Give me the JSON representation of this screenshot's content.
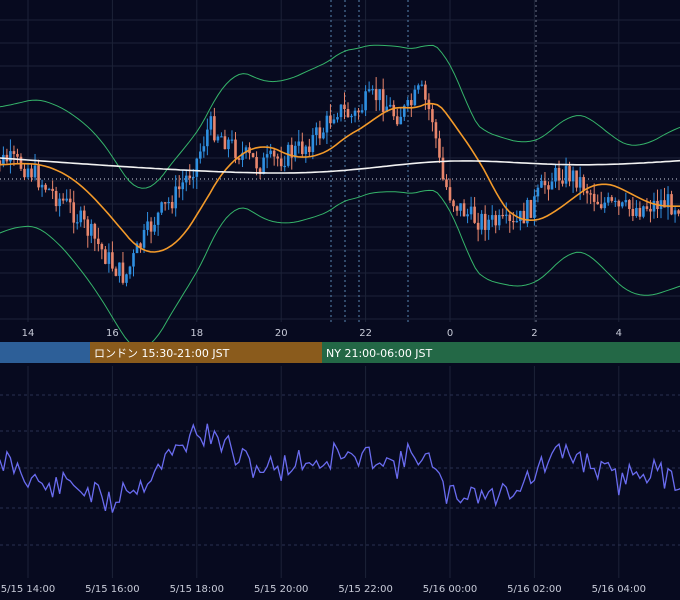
{
  "colors": {
    "background": "#070a1f",
    "grid": "#1c2238",
    "bull": "#2f8fe0",
    "bear": "#e8866c",
    "bollinger": "#35b46a",
    "ma_short": "#f39a2a",
    "ma_long": "#f2f2f2",
    "oscillator": "#6a6cf0",
    "session_tokyo": "#2d5f98",
    "session_london": "#8a5b1c",
    "session_ny": "#236846"
  },
  "chart_data": [
    {
      "type": "candlestick",
      "title": "",
      "x_ticks": [
        "14",
        "16",
        "18",
        "20",
        "22",
        "0",
        "2",
        "4"
      ],
      "series": [
        {
          "type": "candlestick"
        },
        {
          "type": "line",
          "indicator": "bollinger_upper"
        },
        {
          "type": "line",
          "indicator": "bollinger_lower"
        },
        {
          "type": "line",
          "indicator": "moving_average_short"
        },
        {
          "type": "line",
          "indicator": "moving_average_long"
        }
      ],
      "close_path": [
        [
          13.0,
          0.5
        ],
        [
          13.5,
          0.48
        ],
        [
          14.0,
          0.51
        ],
        [
          14.5,
          0.6
        ],
        [
          15.0,
          0.67
        ],
        [
          15.5,
          0.78
        ],
        [
          16.0,
          0.9
        ],
        [
          16.3,
          0.95
        ],
        [
          16.6,
          0.84
        ],
        [
          17.0,
          0.72
        ],
        [
          17.5,
          0.62
        ],
        [
          18.0,
          0.48
        ],
        [
          18.3,
          0.34
        ],
        [
          18.7,
          0.4
        ],
        [
          19.0,
          0.45
        ],
        [
          19.5,
          0.5
        ],
        [
          20.0,
          0.47
        ],
        [
          20.5,
          0.43
        ],
        [
          21.0,
          0.36
        ],
        [
          21.3,
          0.27
        ],
        [
          21.7,
          0.31
        ],
        [
          22.0,
          0.25
        ],
        [
          22.3,
          0.22
        ],
        [
          22.7,
          0.3
        ],
        [
          23.0,
          0.28
        ],
        [
          23.3,
          0.2
        ],
        [
          23.6,
          0.32
        ],
        [
          23.8,
          0.55
        ],
        [
          24.1,
          0.65
        ],
        [
          24.5,
          0.71
        ],
        [
          25.0,
          0.73
        ],
        [
          25.5,
          0.75
        ],
        [
          26.0,
          0.65
        ],
        [
          26.3,
          0.56
        ],
        [
          26.7,
          0.53
        ],
        [
          27.0,
          0.55
        ],
        [
          27.5,
          0.64
        ],
        [
          28.0,
          0.68
        ],
        [
          28.5,
          0.67
        ],
        [
          29.0,
          0.65
        ],
        [
          29.6,
          0.66
        ]
      ],
      "legend": "none"
    },
    {
      "type": "line",
      "title": "",
      "x_ticks": [
        "5/15 14:00",
        "5/15 16:00",
        "5/15 18:00",
        "5/15 20:00",
        "5/15 22:00",
        "5/16 00:00",
        "5/16 02:00",
        "5/16 04:00"
      ],
      "series": [
        {
          "type": "line",
          "indicator": "oscillator"
        }
      ],
      "path": [
        [
          13.0,
          0.55
        ],
        [
          13.5,
          0.4
        ],
        [
          14.0,
          0.5
        ],
        [
          14.5,
          0.6
        ],
        [
          15.0,
          0.55
        ],
        [
          15.5,
          0.62
        ],
        [
          16.0,
          0.7
        ],
        [
          16.3,
          0.55
        ],
        [
          16.6,
          0.6
        ],
        [
          17.0,
          0.45
        ],
        [
          17.5,
          0.35
        ],
        [
          18.0,
          0.2
        ],
        [
          18.3,
          0.25
        ],
        [
          18.7,
          0.3
        ],
        [
          19.0,
          0.4
        ],
        [
          19.5,
          0.45
        ],
        [
          20.0,
          0.45
        ],
        [
          20.5,
          0.4
        ],
        [
          21.0,
          0.42
        ],
        [
          21.3,
          0.35
        ],
        [
          21.7,
          0.4
        ],
        [
          22.0,
          0.4
        ],
        [
          22.3,
          0.35
        ],
        [
          22.7,
          0.45
        ],
        [
          23.0,
          0.38
        ],
        [
          23.3,
          0.35
        ],
        [
          23.6,
          0.45
        ],
        [
          23.8,
          0.6
        ],
        [
          24.1,
          0.65
        ],
        [
          24.5,
          0.6
        ],
        [
          25.0,
          0.65
        ],
        [
          25.5,
          0.58
        ],
        [
          26.0,
          0.5
        ],
        [
          26.3,
          0.42
        ],
        [
          26.7,
          0.35
        ],
        [
          27.0,
          0.38
        ],
        [
          27.5,
          0.45
        ],
        [
          28.0,
          0.55
        ],
        [
          28.5,
          0.45
        ],
        [
          29.0,
          0.5
        ],
        [
          29.6,
          0.55
        ]
      ],
      "legend": "none"
    }
  ],
  "sessions": [
    {
      "label": ""
    },
    {
      "label": "ロンドン 15:30-21:00 JST"
    },
    {
      "label": "NY 21:00-06:00 JST"
    }
  ]
}
